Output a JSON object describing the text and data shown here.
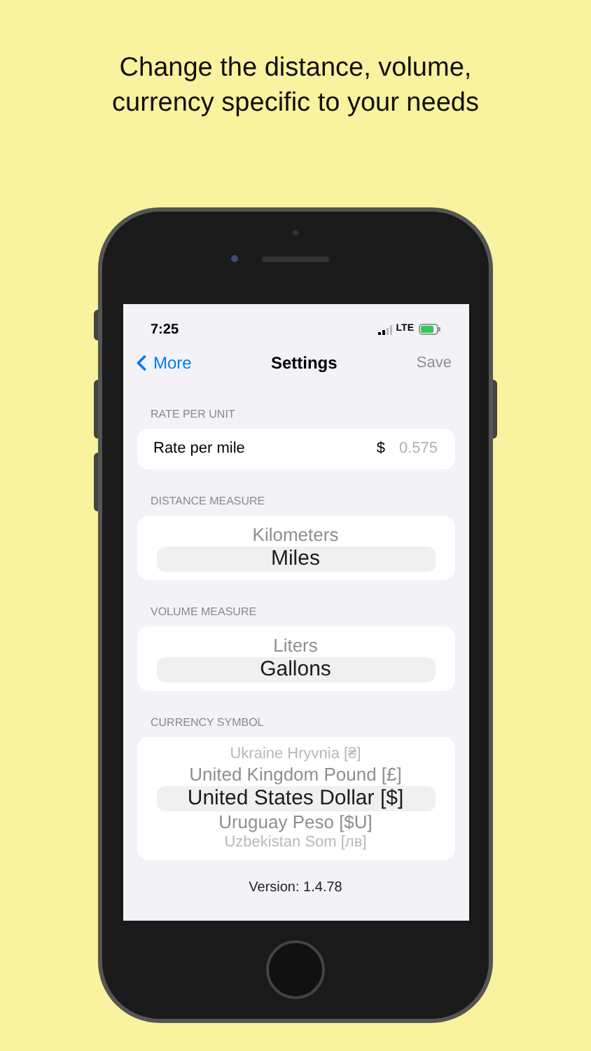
{
  "headline": "Change the distance, volume, currency specific to your needs",
  "status_bar": {
    "time": "7:25",
    "network": "LTE"
  },
  "nav": {
    "back": "More",
    "title": "Settings",
    "action": {
      "label": "Save",
      "disabled": true
    }
  },
  "rate": {
    "header": "RATE PER UNIT",
    "label": "Rate per mile",
    "currency": "$",
    "value": "0.575"
  },
  "pickers": [
    {
      "header": "DISTANCE MEASURE",
      "options": [
        {
          "label": "Kilometers",
          "selected": false
        },
        {
          "label": "Miles",
          "selected": true
        }
      ]
    },
    {
      "header": "VOLUME MEASURE",
      "options": [
        {
          "label": "Liters",
          "selected": false
        },
        {
          "label": "Gallons",
          "selected": true
        }
      ]
    },
    {
      "header": "CURRENCY SYMBOL",
      "options": [
        {
          "label": "Ukraine Hryvnia [₴]",
          "selected": false
        },
        {
          "label": "United Kingdom Pound [£]",
          "selected": false
        },
        {
          "label": "United States Dollar [$]",
          "selected": true
        },
        {
          "label": "Uruguay Peso [$U]",
          "selected": false
        },
        {
          "label": "Uzbekistan Som [лв]",
          "selected": false
        }
      ]
    }
  ],
  "version": "Version: 1.4.78"
}
